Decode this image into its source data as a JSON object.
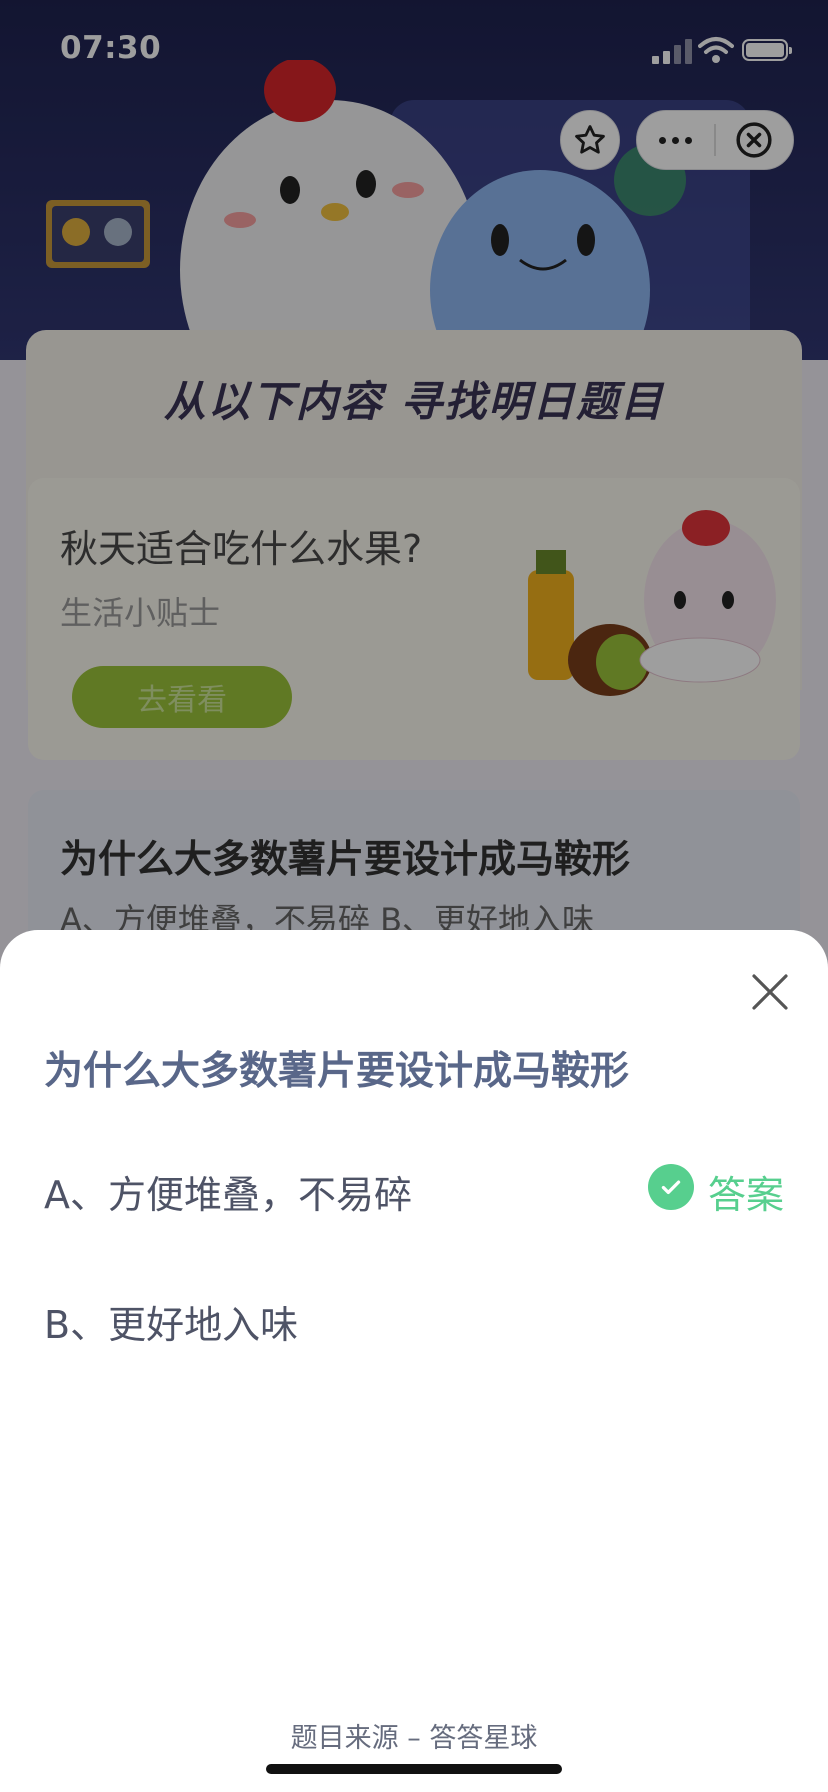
{
  "status_bar": {
    "time": "07:30"
  },
  "mini_program_bar": {
    "favorite_icon": "star-icon",
    "more_icon": "more-dots-icon",
    "close_icon": "close-circle-icon"
  },
  "banner": {
    "title": "从以下内容 寻找明日题目"
  },
  "cards": [
    {
      "title": "秋天适合吃什么水果?",
      "subtitle": "生活小贴士",
      "button": "去看看"
    },
    {
      "title": "为什么大多数薯片要设计成马鞍形",
      "options_line": "A、方便堆叠，不易碎    B、更好地入味"
    }
  ],
  "sheet": {
    "question": "为什么大多数薯片要设计成马鞍形",
    "option_a": "A、方便堆叠，不易碎",
    "option_b": "B、更好地入味",
    "answer_label": "答案",
    "answer_color": "#57cf8e",
    "source": "题目来源 – 答答星球"
  }
}
